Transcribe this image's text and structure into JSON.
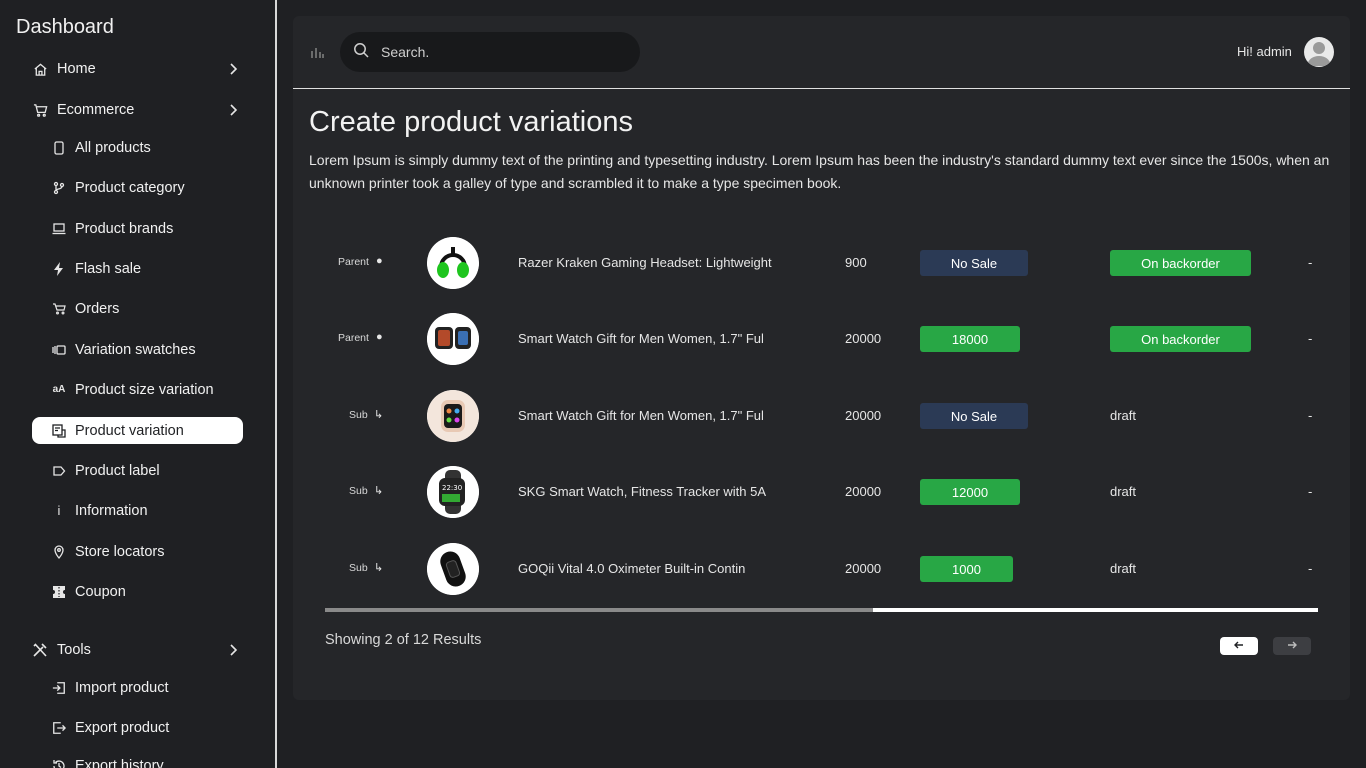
{
  "sidebar": {
    "title": "Dashboard",
    "groups": [
      {
        "label": "Home",
        "icon": "home-icon"
      },
      {
        "label": "Ecommerce",
        "icon": "cart-icon"
      },
      {
        "label": "Tools",
        "icon": "tools-icon"
      }
    ],
    "items": [
      {
        "label": "All products",
        "icon": "phone-icon"
      },
      {
        "label": "Product category",
        "icon": "branch-icon"
      },
      {
        "label": "Product brands",
        "icon": "laptop-icon"
      },
      {
        "label": "Flash sale",
        "icon": "bolt-icon"
      },
      {
        "label": "Orders",
        "icon": "basket-icon"
      },
      {
        "label": "Variation swatches",
        "icon": "swatch-icon"
      },
      {
        "label": "Product size variation",
        "icon": "text-size-icon"
      },
      {
        "label": "Product variation",
        "icon": "variation-icon",
        "active": true
      },
      {
        "label": "Product label",
        "icon": "label-icon"
      },
      {
        "label": "Information",
        "icon": "info-icon"
      },
      {
        "label": "Store locators",
        "icon": "pin-icon"
      },
      {
        "label": "Coupon",
        "icon": "coupon-icon"
      }
    ],
    "tools_items": [
      {
        "label": "Import product",
        "icon": "import-icon"
      },
      {
        "label": "Export product",
        "icon": "export-icon"
      },
      {
        "label": "Export history",
        "icon": "history-icon"
      }
    ]
  },
  "header": {
    "search_placeholder": "Search.",
    "greeting": "Hi! admin"
  },
  "page": {
    "title": "Create product variations",
    "description": "Lorem Ipsum is simply dummy text of the printing and typesetting industry. Lorem Ipsum has been the industry's standard dummy text ever since the 1500s, when an unknown printer took a galley of type and scrambled it to make a type specimen book."
  },
  "rows": [
    {
      "kind": "Parent",
      "name": "Razer Kraken Gaming Headset: Lightweight",
      "price": "900",
      "sale": "No Sale",
      "sale_type": "nosale",
      "status": "On backorder",
      "status_type": "badge",
      "extra": "-"
    },
    {
      "kind": "Parent",
      "name": "Smart Watch Gift for Men Women, 1.7\" Ful",
      "price": "20000",
      "sale": "18000",
      "sale_type": "green",
      "status": "On backorder",
      "status_type": "badge",
      "extra": "-"
    },
    {
      "kind": "Sub",
      "name": "Smart Watch Gift for Men Women, 1.7\" Ful",
      "price": "20000",
      "sale": "No Sale",
      "sale_type": "nosale",
      "status": "draft",
      "status_type": "text",
      "extra": "-"
    },
    {
      "kind": "Sub",
      "name": "SKG Smart Watch, Fitness Tracker with 5A",
      "price": "20000",
      "sale": "12000",
      "sale_type": "green",
      "status": "draft",
      "status_type": "text",
      "extra": "-"
    },
    {
      "kind": "Sub",
      "name": "GOQii Vital 4.0 Oximeter Built-in Contin",
      "price": "20000",
      "sale": "1000",
      "sale_type": "green",
      "status": "draft",
      "status_type": "text",
      "extra": "-"
    }
  ],
  "footer": {
    "results_text": "Showing 2 of 12 Results",
    "prev_icon": "arrow-left-icon",
    "next_icon": "arrow-right-icon"
  },
  "colors": {
    "background": "#1f2023",
    "panel": "#252629",
    "green": "#28a745",
    "navy": "#2b3a55"
  }
}
